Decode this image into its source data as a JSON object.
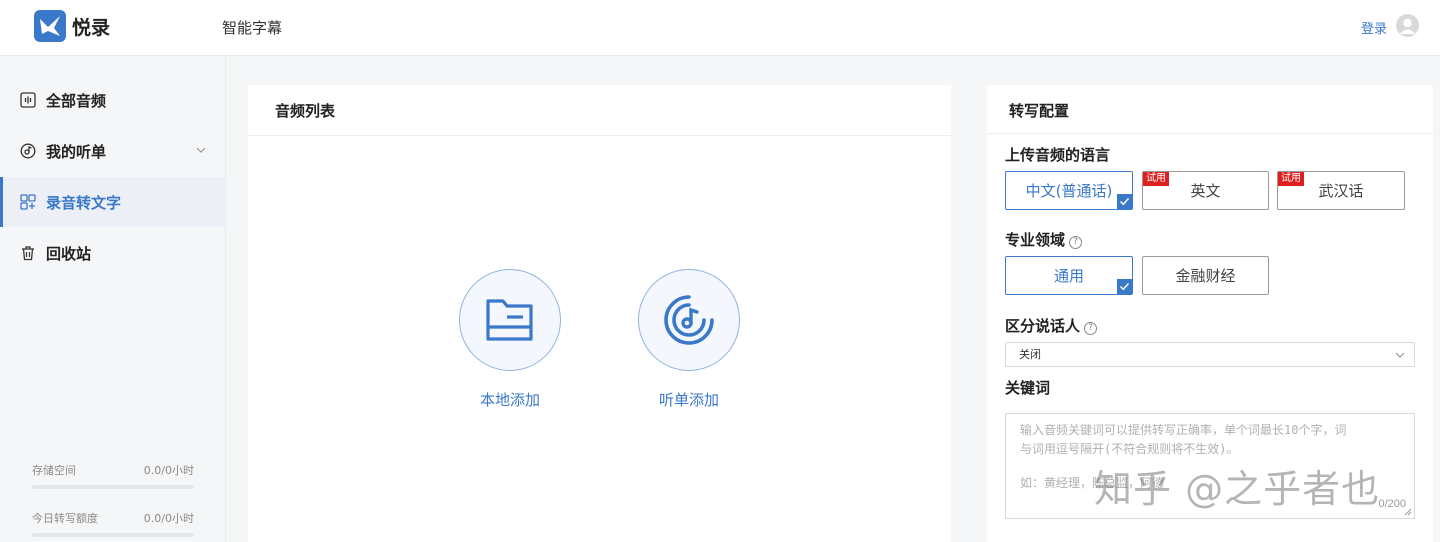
{
  "app": {
    "brand": "悦录",
    "page_title": "智能字幕",
    "login_label": "登录"
  },
  "sidebar": {
    "items": [
      {
        "label": "全部音频",
        "icon": "audio-wave-icon"
      },
      {
        "label": "我的听单",
        "icon": "music-disc-icon"
      },
      {
        "label": "录音转文字",
        "icon": "transcribe-icon",
        "active": true
      },
      {
        "label": "回收站",
        "icon": "trash-icon"
      }
    ],
    "storage": {
      "label": "存储空间",
      "value": "0.0/0小时",
      "fill": 0
    },
    "quota": {
      "label": "今日转写额度",
      "value": "0.0/0小时",
      "fill": 0
    }
  },
  "audio_list": {
    "title": "音频列表",
    "local_add": "本地添加",
    "playlist_add": "听单添加"
  },
  "config": {
    "title": "转写配置",
    "language": {
      "label": "上传音频的语言",
      "options": [
        {
          "label": "中文(普通话)",
          "selected": true
        },
        {
          "label": "英文",
          "badge": "试用"
        },
        {
          "label": "武汉话",
          "badge": "试用"
        }
      ]
    },
    "domain": {
      "label": "专业领域",
      "help": "?",
      "options": [
        {
          "label": "通用",
          "selected": true
        },
        {
          "label": "金融财经"
        }
      ]
    },
    "speaker": {
      "label": "区分说话人",
      "help": "?",
      "value": "关闭"
    },
    "keywords": {
      "label": "关键词",
      "placeholder_line1": "输入音频关键词可以提供转写正确率，单个词最长10个字，词",
      "placeholder_line2": "与词用逗号隔开(不符合规则将不生效)。",
      "example": "如：黄经理，陈总监，阿德",
      "counter": "0/200"
    }
  },
  "watermark": "知乎 @之乎者也",
  "colors": {
    "accent": "#3a78c9",
    "trial_badge": "#e02020"
  }
}
